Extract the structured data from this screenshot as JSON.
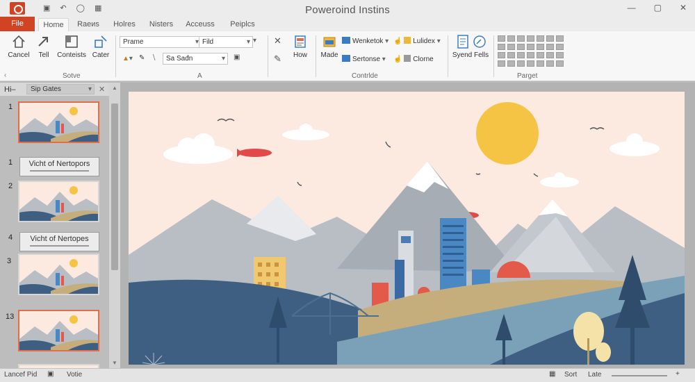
{
  "window": {
    "title": "Poweroind Instins"
  },
  "tabs": [
    "File",
    "Home",
    "Raеиs",
    "Holres",
    "Nisters",
    "Acceuss",
    "Peiplcs"
  ],
  "ribbon": {
    "clipboard": {
      "cancel": "Cancel",
      "tell": "Tell",
      "contents": "Conteists",
      "cater": "Cater",
      "label": "Sotve"
    },
    "font": {
      "name_placeholder": "Prame",
      "bold_box": "Fild",
      "size_box": "Sa Sađn",
      "label": "A"
    },
    "editing": {
      "how": "How"
    },
    "controls": {
      "made": "Made",
      "workdes": "Wenketok",
      "sertonse": "Sertonse",
      "lulidex": "Lulidex",
      "clorne": "Clorne",
      "label": "Contrlde"
    },
    "symbol": {
      "label": "Syend Fells"
    },
    "pages": {
      "label": "Parget"
    }
  },
  "slide_panel": {
    "header_left": "Hi–",
    "header_dropdown": "Sip Gates",
    "numbers": [
      "1",
      "1",
      "2",
      "4",
      "3",
      "13"
    ],
    "title_slide_text": "Vicht of Nertopors",
    "title_slide_text_2": "Vicht of Nertopes"
  },
  "statusbar": {
    "left": "Lancef Pid",
    "notes": "Votie",
    "sort": "Sort",
    "late": "Late"
  }
}
